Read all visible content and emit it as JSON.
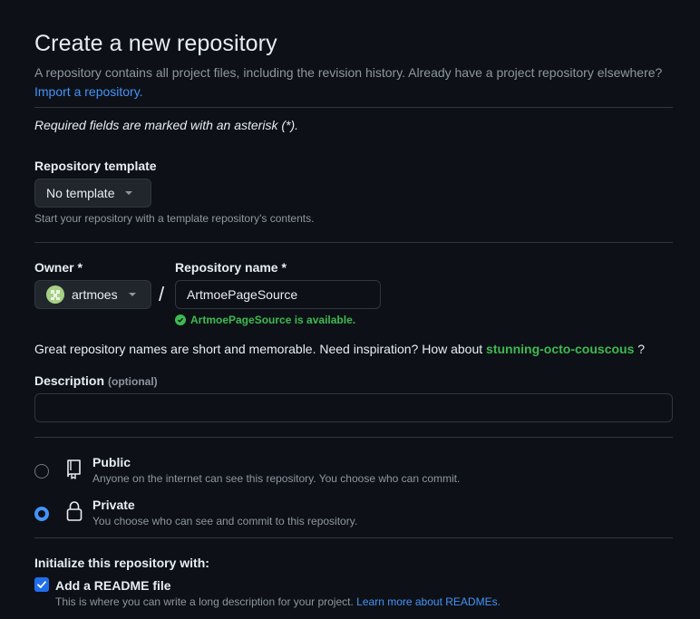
{
  "header": {
    "title": "Create a new repository",
    "subtitle": "A repository contains all project files, including the revision history. Already have a project repository elsewhere?",
    "import_link": "Import a repository."
  },
  "required_note": "Required fields are marked with an asterisk (*).",
  "template": {
    "label": "Repository template",
    "value": "No template",
    "helper": "Start your repository with a template repository's contents."
  },
  "owner": {
    "label": "Owner *",
    "value": "artmoes"
  },
  "separator": "/",
  "repo_name": {
    "label": "Repository name *",
    "value": "ArtmoePageSource",
    "availability": "ArtmoePageSource is available."
  },
  "inspiration": {
    "text": "Great repository names are short and memorable. Need inspiration? How about",
    "suggestion": "stunning-octo-couscous",
    "suffix": "?"
  },
  "description": {
    "label": "Description",
    "optional": "(optional)",
    "value": "",
    "placeholder": ""
  },
  "visibility": {
    "selected": "private",
    "public": {
      "title": "Public",
      "desc": "Anyone on the internet can see this repository. You choose who can commit."
    },
    "private": {
      "title": "Private",
      "desc": "You choose who can see and commit to this repository."
    }
  },
  "init": {
    "heading": "Initialize this repository with:",
    "readme_label": "Add a README file",
    "readme_checked": true,
    "readme_desc": "This is where you can write a long description for your project.",
    "readme_link": "Learn more about READMEs."
  },
  "colors": {
    "background": "#0d1117",
    "accent": "#4493f8",
    "success": "#3fb950",
    "checkbox": "#1f6feb",
    "border": "#30363d",
    "muted": "#8d96a0"
  }
}
